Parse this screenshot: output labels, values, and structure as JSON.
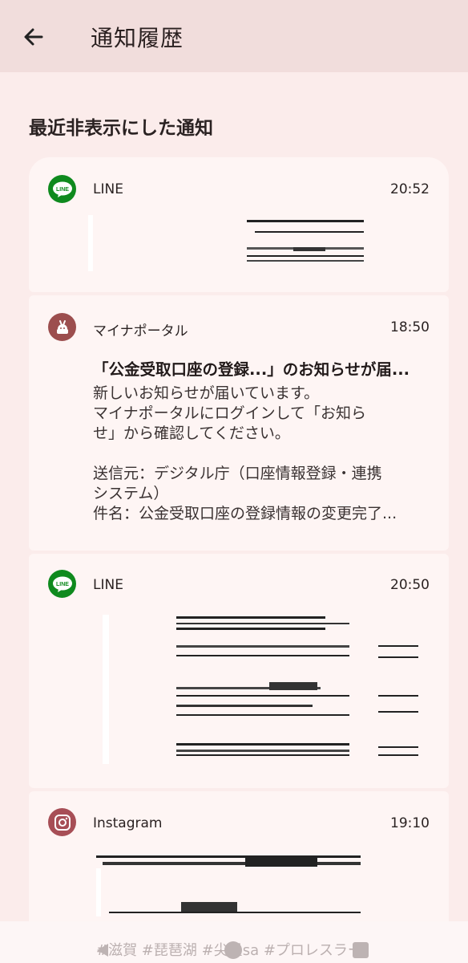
{
  "appbar": {
    "title": "通知履歴"
  },
  "section": {
    "title": "最近非表示にした通知"
  },
  "notifications": [
    {
      "app": "LINE",
      "time": "20:52"
    },
    {
      "app": "マイナポータル",
      "time": "18:50",
      "title": "「公金受取口座の登録...」のお知らせが届...",
      "body": [
        "新しいお知らせが届いています。",
        "マイナポータルにログインして「お知ら",
        "せ」から確認してください。",
        "",
        "送信元：デジタル庁（口座情報登録・連携",
        "システム）",
        "件名：公金受取口座の登録情報の変更完了..."
      ]
    },
    {
      "app": "LINE",
      "time": "20:50"
    },
    {
      "app": "Instagram",
      "time": "19:10"
    }
  ],
  "navbar": {
    "ghost_text": "#滋賀 #琵琶湖 #尖星sa #プロレスラー」"
  },
  "icons": {
    "line": "line-app-icon",
    "myna": "mynaportal-app-icon",
    "instagram": "instagram-app-icon"
  }
}
